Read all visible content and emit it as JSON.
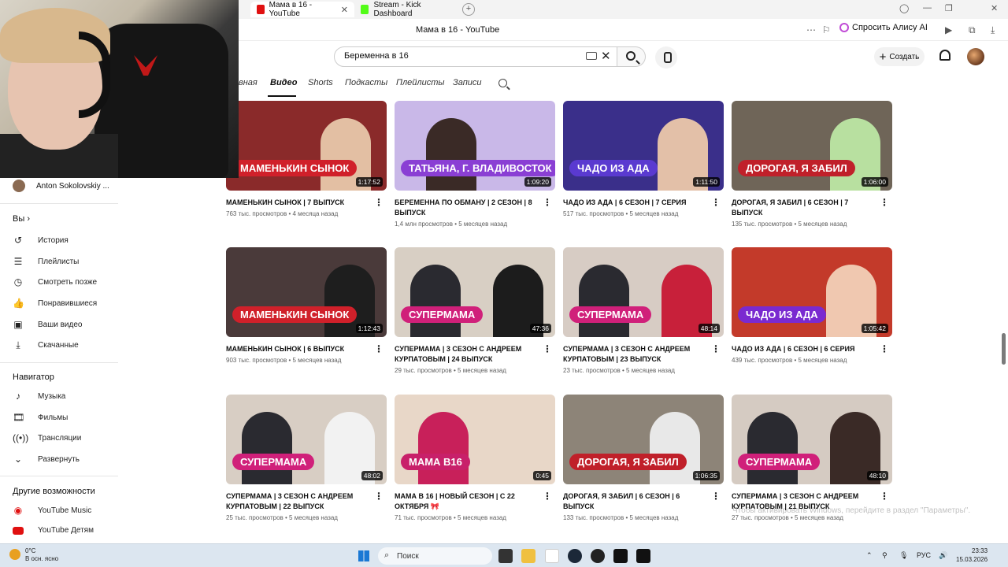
{
  "browser": {
    "tabs": [
      {
        "title": "Мама в 16 - YouTube",
        "close": "✕"
      },
      {
        "title": "Stream - Kick Dashboard"
      }
    ],
    "new_tab": "+",
    "page_title": "Мама в 16 - YouTube",
    "alice_label": "Спросить Алису AI"
  },
  "youtube": {
    "search_value": "Беременна в 16",
    "create_label": "Создать",
    "channel_tabs": [
      "вная",
      "Видео",
      "Shorts",
      "Подкасты",
      "Плейлисты",
      "Записи"
    ]
  },
  "sidebar": {
    "subscription": "Anton Sokolovskiy ...",
    "you_header": "Вы",
    "you_items": [
      "История",
      "Плейлисты",
      "Смотреть позже",
      "Понравившиеся",
      "Ваши видео",
      "Скачанные"
    ],
    "navigator_header": "Навигатор",
    "navigator_items": [
      "Музыка",
      "Фильмы",
      "Трансляции",
      "Развернуть"
    ],
    "other_header": "Другие возможности",
    "other_items": [
      "YouTube Music",
      "YouTube Детям"
    ]
  },
  "videos": [
    {
      "title": "МАМЕНЬКИН СЫНОК | 7 ВЫПУСК",
      "meta": "763 тыс. просмотров • 4 месяца назад",
      "duration": "1:17:52",
      "banner": "МАМЕНЬКИН СЫНОК",
      "color": "#8a2a2a",
      "banner_color": "#d0202a"
    },
    {
      "title": "БЕРЕМЕННА ПО ОБМАНУ | 2 СЕЗОН | 8 ВЫПУСК",
      "meta": "1,4 млн просмотров • 5 месяцев назад",
      "duration": "1:09:20",
      "banner": "ТАТЬЯНА, Г. ВЛАДИВОСТОК",
      "color": "#c9b8e8",
      "banner_color": "#8a3fd4"
    },
    {
      "title": "ЧАДО ИЗ АДА | 6 СЕЗОН | 7 СЕРИЯ",
      "meta": "517 тыс. просмотров • 5 месяцев назад",
      "duration": "1:11:50",
      "banner": "ЧАДО ИЗ АДА",
      "color": "#3a2f8a",
      "banner_color": "#5a3ad0"
    },
    {
      "title": "ДОРОГАЯ, Я ЗАБИЛ | 6 СЕЗОН | 7 ВЫПУСК",
      "meta": "135 тыс. просмотров • 5 месяцев назад",
      "duration": "1:06:00",
      "banner": "ДОРОГАЯ, Я ЗАБИЛ",
      "color": "#6f6558",
      "banner_color": "#c0202a"
    },
    {
      "title": "МАМЕНЬКИН СЫНОК | 6 ВЫПУСК",
      "meta": "903 тыс. просмотров • 5 месяцев назад",
      "duration": "1:12:43",
      "banner": "МАМЕНЬКИН СЫНОК",
      "color": "#4a3a3a",
      "banner_color": "#d0202a"
    },
    {
      "title": "СУПЕРМАМА | 3 СЕЗОН С АНДРЕЕМ КУРПАТОВЫМ | 24 ВЫПУСК",
      "meta": "29 тыс. просмотров • 5 месяцев назад",
      "duration": "47:36",
      "banner": "СУПЕРМАМА",
      "color": "#d8cfc4",
      "banner_color": "#d0207a"
    },
    {
      "title": "СУПЕРМАМА | 3 СЕЗОН С АНДРЕЕМ КУРПАТОВЫМ | 23 ВЫПУСК",
      "meta": "23 тыс. просмотров • 5 месяцев назад",
      "duration": "48:14",
      "banner": "СУПЕРМАМА",
      "color": "#d7ccc4",
      "banner_color": "#d0207a"
    },
    {
      "title": "ЧАДО ИЗ АДА | 6 СЕЗОН | 6 СЕРИЯ",
      "meta": "439 тыс. просмотров • 5 месяцев назад",
      "duration": "1:05:42",
      "banner": "ЧАДО ИЗ АДА",
      "color": "#c33a2a",
      "banner_color": "#7a2ad0"
    },
    {
      "title": "СУПЕРМАМА | 3 СЕЗОН С АНДРЕЕМ КУРПАТОВЫМ | 22 ВЫПУСК",
      "meta": "25 тыс. просмотров • 5 месяцев назад",
      "duration": "48:02",
      "banner": "СУПЕРМАМА",
      "color": "#d8cec4",
      "banner_color": "#d0207a"
    },
    {
      "title": "МАМА В 16 | НОВЫЙ СЕЗОН | С 22 ОКТЯБРЯ 🎀",
      "meta": "71 тыс. просмотров • 5 месяцев назад",
      "duration": "0:45",
      "banner": "МАМА В16",
      "color": "#e8d7c8",
      "banner_color": "#c8206a"
    },
    {
      "title": "ДОРОГАЯ, Я ЗАБИЛ | 6 СЕЗОН | 6 ВЫПУСК",
      "meta": "133 тыс. просмотров • 5 месяцев назад",
      "duration": "1:06:35",
      "banner": "ДОРОГАЯ, Я ЗАБИЛ",
      "color": "#8d8478",
      "banner_color": "#c0202a"
    },
    {
      "title": "СУПЕРМАМА | 3 СЕЗОН С АНДРЕЕМ КУРПАТОВЫМ | 21 ВЫПУСК",
      "meta": "27 тыс. просмотров • 5 месяцев назад",
      "duration": "48:10",
      "banner": "СУПЕРМАМА",
      "color": "#d5cbc2",
      "banner_color": "#d0207a"
    }
  ],
  "watermark": "Чтобы активировать Windows, перейдите в раздел \"Параметры\".",
  "taskbar": {
    "weather_temp": "0°C",
    "weather_desc": "В осн. ясно",
    "search_label": "Поиск",
    "lang": "РУС",
    "time": "23:33",
    "date": "15.03.2026"
  }
}
